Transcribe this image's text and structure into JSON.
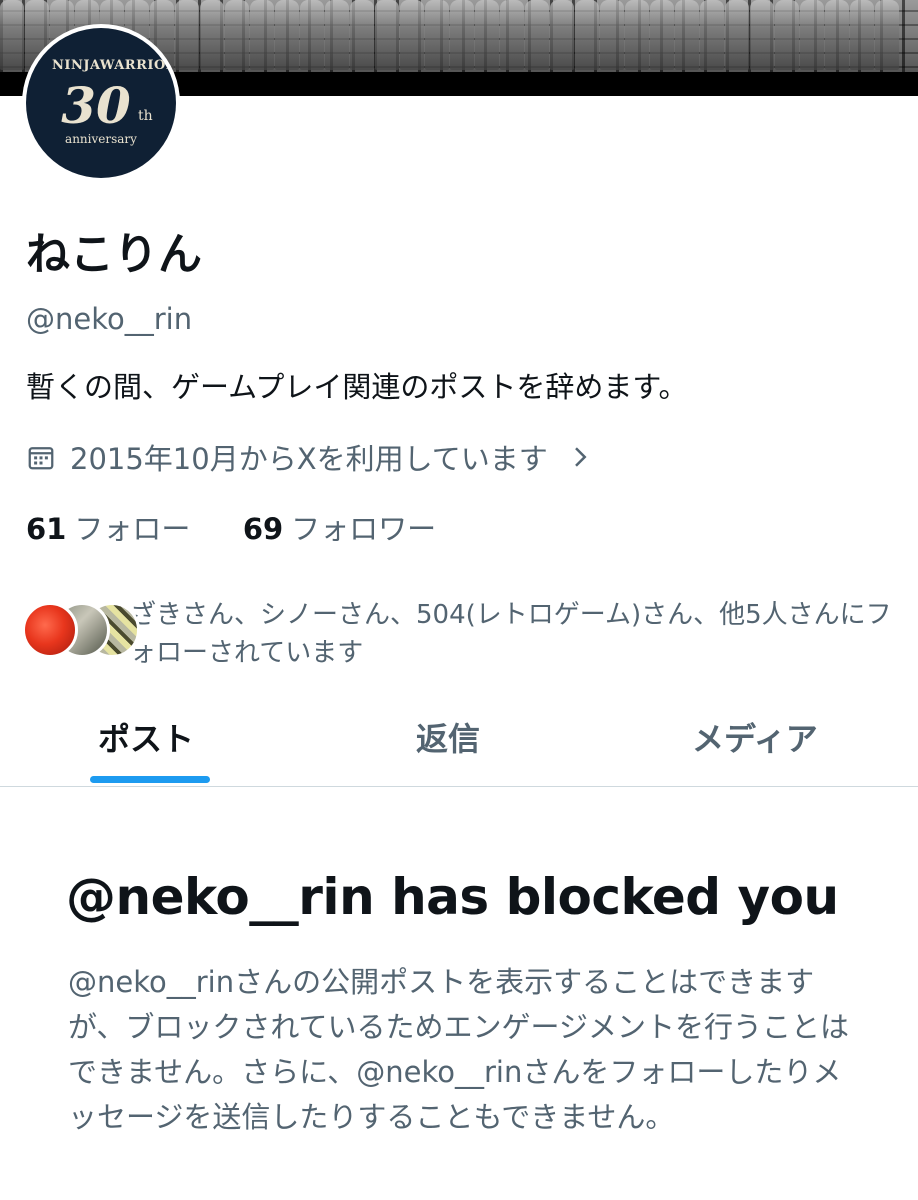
{
  "profile": {
    "name": "ねこりん",
    "handle": "@neko__rin",
    "bio": "暫くの間、ゲームプレイ関連のポストを辞めます。",
    "joined": "2015年10月からXを利用しています",
    "avatar": {
      "logo_top": "NINJAWARRIORS",
      "logo_number": "30",
      "logo_suffix": "th",
      "logo_sub": "anniversary"
    }
  },
  "stats": {
    "following_count": "61",
    "following_label": "フォロー",
    "followers_count": "69",
    "followers_label": "フォロワー"
  },
  "known_followers": "ざきさん、シノーさん、504(レトロゲーム)さん、他5人さんにフォローされています",
  "tabs": [
    {
      "label": "ポスト",
      "active": true
    },
    {
      "label": "返信",
      "active": false
    },
    {
      "label": "メディア",
      "active": false
    }
  ],
  "block_notice": {
    "title": "@neko__rin has blocked you",
    "body": "@neko__rinさんの公開ポストを表示することはできますが、ブロックされているためエンゲージメントを行うことはできません。さらに、@neko__rinさんをフォローしたりメッセージを送信したりすることもできません。"
  },
  "colors": {
    "accent": "#1d9bf0",
    "text_primary": "#0f1419",
    "text_secondary": "#536471",
    "divider": "#cfd9de"
  },
  "icons": [
    "calendar-icon",
    "chevron-right-icon"
  ]
}
